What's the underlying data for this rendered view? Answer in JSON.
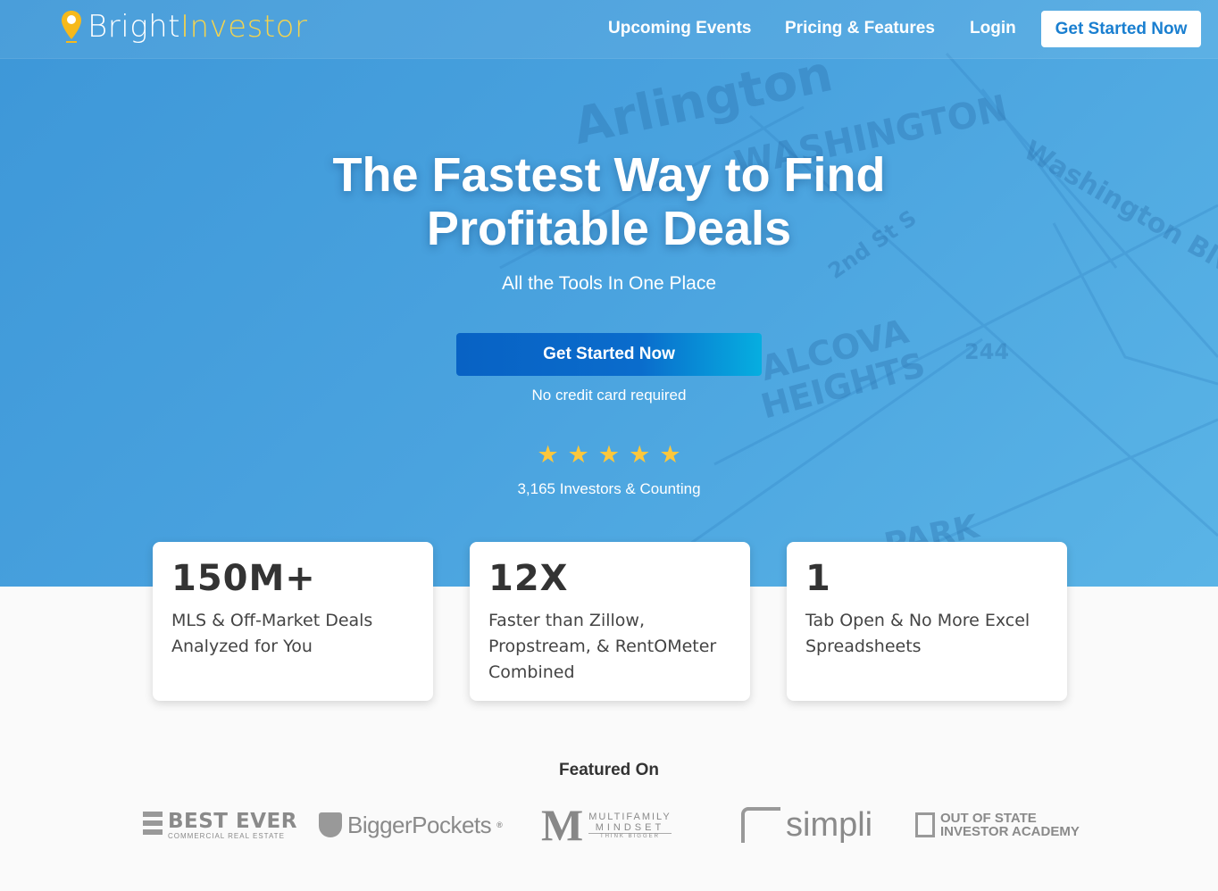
{
  "nav": {
    "logo_part1": "Bright",
    "logo_part2": "Investor",
    "links": [
      "Upcoming Events",
      "Pricing & Features",
      "Login"
    ],
    "cta": "Get Started Now"
  },
  "hero": {
    "title_line1": "The Fastest Way to Find",
    "title_line2": "Profitable Deals",
    "subtitle": "All the Tools In One Place",
    "cta": "Get Started Now",
    "note": "No credit card required",
    "rating": 5,
    "count_text": "3,165 Investors & Counting"
  },
  "map_labels": [
    "Arlington",
    "WASHINGTON",
    "Washington Blvd",
    "2nd St S",
    "ALCOVA",
    "HEIGHTS",
    "244",
    "PARK"
  ],
  "stats": [
    {
      "value": "150M+",
      "desc": "MLS & Off-Market Deals Analyzed for You"
    },
    {
      "value": "12X",
      "desc": "Faster than Zillow, Propstream, & RentOMeter Combined"
    },
    {
      "value": "1",
      "desc": "Tab Open & No More Excel Spreadsheets"
    }
  ],
  "featured": {
    "heading": "Featured On",
    "logos": [
      {
        "name": "BEST EVER",
        "sub": "COMMERCIAL REAL ESTATE"
      },
      {
        "name": "BiggerPockets"
      },
      {
        "name": "MULTIFAMILY",
        "sub": "MINDSET",
        "sub2": "THINK BIGGER"
      },
      {
        "name": "simpli"
      },
      {
        "name": "OUT OF STATE",
        "sub": "INVESTOR ACADEMY"
      }
    ]
  },
  "colors": {
    "accent": "#1a7fd0",
    "star": "#fcc73c",
    "logo_yellow": "#f5d44d"
  }
}
